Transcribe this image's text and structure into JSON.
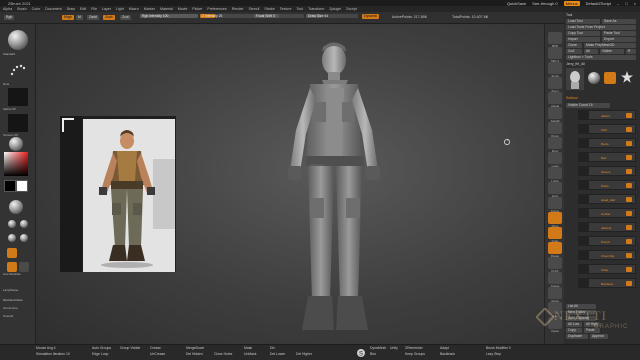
{
  "window": {
    "title": "ZBrush 2021",
    "quicksave": "QuickSave",
    "see_through": "See-through 0",
    "menus_btn": "Menus",
    "default_script": "DefaultZScript"
  },
  "menubar": [
    "Alpha",
    "Brush",
    "Color",
    "Document",
    "Draw",
    "Edit",
    "File",
    "Layer",
    "Light",
    "Macro",
    "Marker",
    "Material",
    "Movie",
    "Picker",
    "Preferences",
    "Render",
    "Stencil",
    "Stroke",
    "Texture",
    "Tool",
    "Transform",
    "Zplugin",
    "Zscript"
  ],
  "toolbar": {
    "rgb": "Rgb",
    "mrgb": "Mrgb",
    "m": "M",
    "zadd": "Zadd",
    "zsub": "Zsub",
    "zcut": "Zcut",
    "rgb_intensity": "Rgb Intensity 100",
    "z_intensity": "Z Intensity 25",
    "focal_shift": "Focal Shift 0",
    "draw_size": "Draw Size 64",
    "dynamic": "Dynamic",
    "active_points": "ActivePoints: 217,896",
    "total_points": "TotalPoints: 10.407 Mil"
  },
  "leftshelf": {
    "standard": "Standard",
    "dots": "Dots",
    "alpha_off": "Alpha Off",
    "texture_off": "Texture Off",
    "matcap": "MatCap Gray",
    "gradient": "Gradient",
    "switch_color": "SwitchColor",
    "alternate": "Alternate",
    "line_illustrate": "Line Illustrate",
    "lazymouse": "LazyMouse",
    "backface": "BackfaceMask",
    "accucurve": "AccuCurve",
    "smooth": "Smooth"
  },
  "rightshelf": [
    "BPR",
    "SPix 3",
    "Scroll",
    "Zoom",
    "Actual",
    "AAHalf",
    "Persp",
    "Floor",
    "Local",
    "L.Sym",
    "Gxyz",
    "Frame",
    "Move",
    "Scale",
    "Rotate",
    "PolyF",
    "Transp",
    "Ghost",
    "Solo",
    "Xpose"
  ],
  "rpanel": {
    "tool": "Tool",
    "load_tool": "Load Tool",
    "save_as": "Save As",
    "load_tools_from_project": "Load Tools From Project",
    "copy_tool": "Copy Tool",
    "paste_tool": "Paste Tool",
    "import": "Import",
    "export": "Export",
    "clone": "Clone",
    "make_polymesh": "Make PolyMesh3D",
    "goz": "GoZ",
    "all": "All",
    "visible": "Visible",
    "r": "R",
    "lightbox_tools": "Lightbox > Tools",
    "current_tool": "Jerry_fbf_All",
    "sphere3d": "Sphere3D",
    "polymesh": "PolyMesh3D",
    "simple_brush": "SimpleBrush",
    "subtool": "Subtool",
    "visible_count": "Visible Count 15",
    "subtools": [
      "Jacket",
      "Shirt",
      "Boots",
      "Belt",
      "Gloves",
      "Pants",
      "Head_Hair",
      "Holster",
      "Jacket2",
      "Pouch",
      "Chest Rig",
      "Strap",
      "Bandana"
    ],
    "list_all": "List All",
    "new_folder": "New Folder",
    "auto_collapse": "Auto Collapse",
    "all_low": "All Low",
    "all_high": "All High",
    "copy": "Copy",
    "paste": "Paste",
    "duplicate": "Duplicate",
    "append": "Append",
    "insert": "Insert",
    "delete": "Delete"
  },
  "bottombar": {
    "mouse_avg": "Mouse Avg 4",
    "simulation_iteration": "Simulation Iteration 10",
    "auto_groups": "Auto Groups",
    "edge_loop": "Edge Loop",
    "group_visible": "Group Visible",
    "crease": "Crease",
    "uncrease": "UnCrease",
    "mergedown": "MergeDown",
    "del_hidden": "Del Hidden",
    "close_holes": "Close Holes",
    "mask": "Mask",
    "unmask": "UnMask",
    "stroke_val": "Stroke",
    "div": "Div",
    "del_lower": "Del Lower",
    "del_higher": "Del Higher",
    "reconstruct": "Reconstruct Subdiv",
    "dynamesh": "DynaMesh",
    "blur": "Blur",
    "unify": "Unify",
    "scale": "Scale",
    "relax": "Relax",
    "zremesher": "ZRemesher",
    "keep_groups": "Keep Groups",
    "adapt": "Adapt",
    "backtrack": "Backtrack",
    "brush_modifier": "Brush Modifier 0",
    "lazy_step": "Lazy Step"
  },
  "watermark": {
    "brand": "NEXTTI",
    "sub": "GRAPHIC"
  },
  "colors": {
    "accent": "#d37a18",
    "panel": "#2d2d2d",
    "viewport": "#474747"
  }
}
